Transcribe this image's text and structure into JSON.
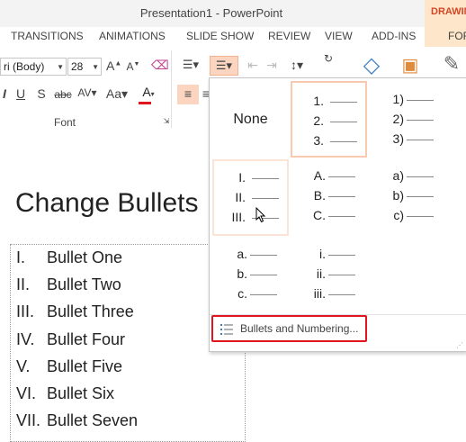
{
  "window": {
    "title": "Presentation1 - PowerPoint",
    "context_tab": "DRAWIN",
    "context_tab_sub": "FOR"
  },
  "tabs": [
    "TRANSITIONS",
    "ANIMATIONS",
    "SLIDE SHOW",
    "REVIEW",
    "VIEW",
    "ADD-INS"
  ],
  "ribbon": {
    "font_name": "ri (Body)",
    "font_size": "28",
    "font_group_label": "Font"
  },
  "slide": {
    "title": "Change Bullets",
    "bullets": [
      {
        "num": "I.",
        "text": "Bullet One"
      },
      {
        "num": "II.",
        "text": "Bullet Two"
      },
      {
        "num": "III.",
        "text": "Bullet Three"
      },
      {
        "num": "IV.",
        "text": "Bullet Four"
      },
      {
        "num": "V.",
        "text": "Bullet Five"
      },
      {
        "num": "VI.",
        "text": "Bullet Six"
      },
      {
        "num": "VII.",
        "text": "Bullet Seven"
      }
    ]
  },
  "gallery": {
    "none_label": "None",
    "options": [
      {
        "id": "numeric-period",
        "markers": [
          "1.",
          "2.",
          "3."
        ]
      },
      {
        "id": "numeric-paren",
        "markers": [
          "1)",
          "2)",
          "3)"
        ]
      },
      {
        "id": "roman-upper",
        "markers": [
          "I.",
          "II.",
          "III."
        ]
      },
      {
        "id": "alpha-upper",
        "markers": [
          "A.",
          "B.",
          "C."
        ]
      },
      {
        "id": "alpha-lower-paren",
        "markers": [
          "a)",
          "b)",
          "c)"
        ]
      },
      {
        "id": "alpha-lower-period",
        "markers": [
          "a.",
          "b.",
          "c."
        ]
      },
      {
        "id": "roman-lower",
        "markers": [
          "i.",
          "ii.",
          "iii."
        ]
      }
    ],
    "bullets_and_numbering_label": "Bullets and Numbering...",
    "bullets_and_numbering_underline": "N"
  }
}
